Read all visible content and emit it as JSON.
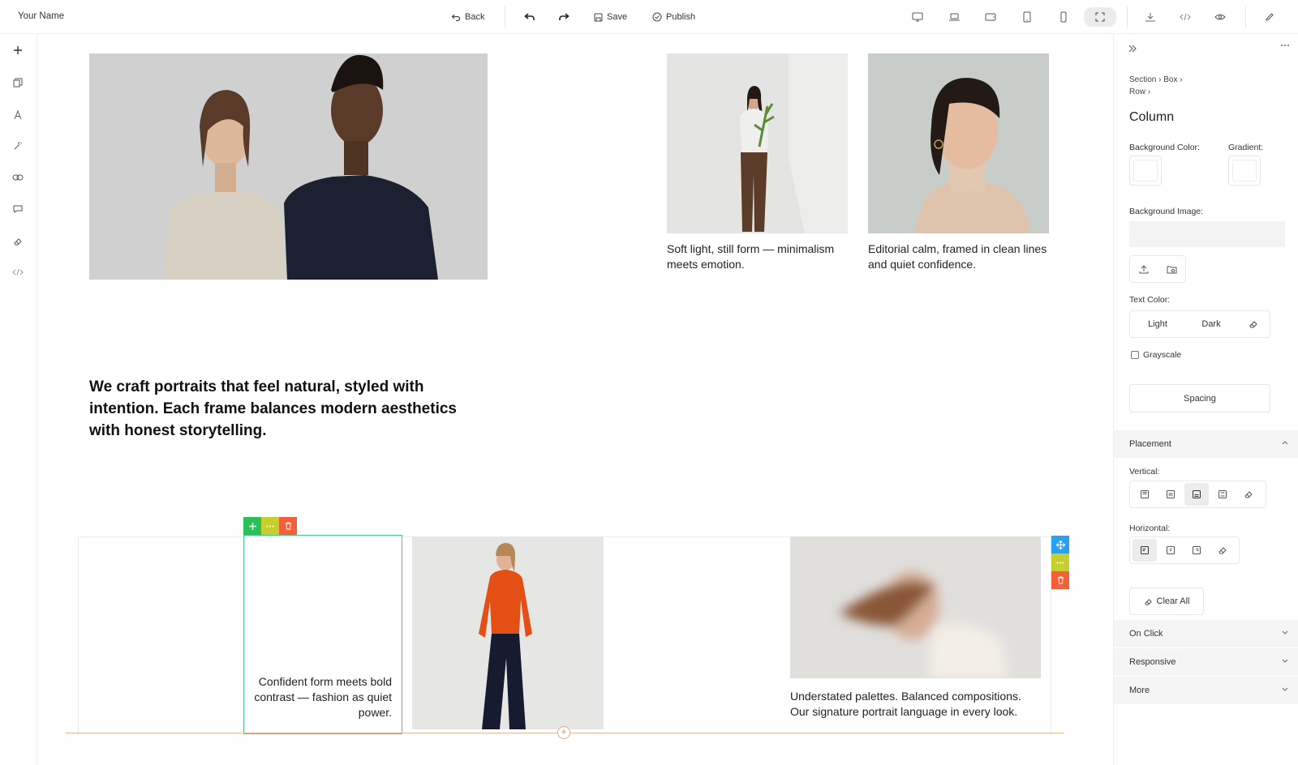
{
  "topbar": {
    "brand": "Your Name",
    "back_label": "Back",
    "save_label": "Save",
    "publish_label": "Publish"
  },
  "canvas": {
    "caption_top_1": "Soft light, still form — minimalism meets emotion.",
    "caption_top_2": "Editorial calm, framed in clean lines and quiet confidence.",
    "headline": "We craft portraits that feel natural, styled with intention. Each frame balances modern aesthetics with honest storytelling.",
    "caption_bottom_1": "Confident form meets bold contrast — fashion as quiet power.",
    "caption_bottom_2": "Understated palettes. Balanced compositions. Our signature portrait language in every look."
  },
  "panel": {
    "breadcrumb": [
      "Section",
      "Box",
      "Row"
    ],
    "title": "Column",
    "bg_color_label": "Background Color:",
    "gradient_label": "Gradient:",
    "bg_image_label": "Background Image:",
    "text_color_label": "Text Color:",
    "light_label": "Light",
    "dark_label": "Dark",
    "grayscale_label": "Grayscale",
    "spacing_label": "Spacing",
    "placement_label": "Placement",
    "vertical_label": "Vertical:",
    "horizontal_label": "Horizontal:",
    "clear_all_label": "Clear All",
    "on_click_label": "On Click",
    "responsive_label": "Responsive",
    "more_label": "More"
  },
  "colors": {
    "select_green": "#3fc88a",
    "ctl_add": "#2bbf55",
    "ctl_more": "#c5cf2e",
    "ctl_delete": "#f2613a",
    "ctl_move": "#2aa0f0"
  }
}
